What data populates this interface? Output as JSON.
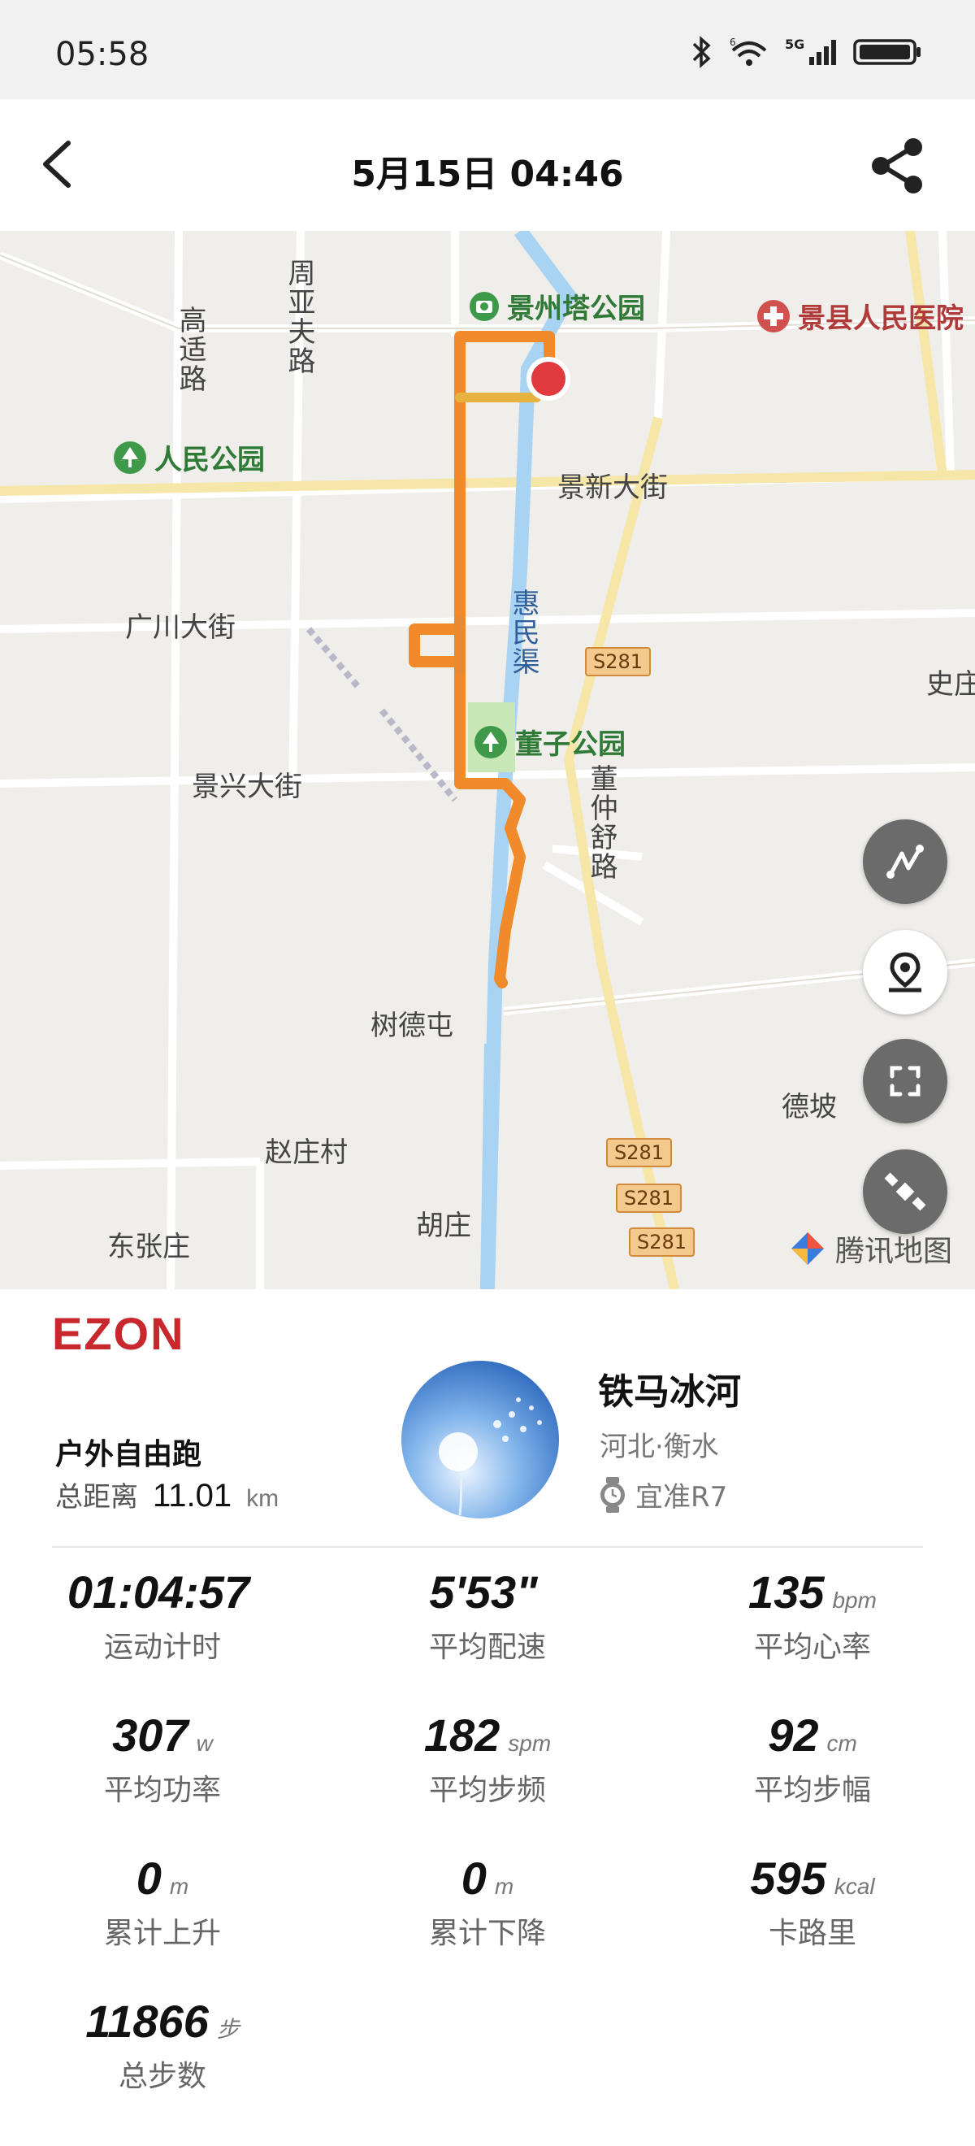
{
  "status_bar": {
    "time": "05:58",
    "signal": "5G",
    "wifi_badge": "6"
  },
  "header": {
    "title": "5月15日  04:46",
    "back_icon": "chevron-left-icon",
    "share_icon": "share-icon"
  },
  "map": {
    "labels": {
      "gaoshi_road": "高适路",
      "zhouya_road": "周亚夫路",
      "jingzhou_park": "景州塔公园",
      "county_hospital": "景县人民医院",
      "renmin_park": "人民公园",
      "jingxin_street": "景新大街",
      "guangchuan_street": "广川大街",
      "huimin_canal": "惠民渠",
      "dongzi_park": "董子公园",
      "jingxing_street": "景兴大街",
      "dongzhongshu_road": "董仲舒路",
      "shi": "史庄",
      "shudetun": "树德屯",
      "depo": "德坡",
      "zhaozhuang": "赵庄村",
      "dongzhang": "东张庄",
      "huzhuang": "胡庄"
    },
    "road_badges": [
      "S281",
      "S281",
      "S281",
      "S281"
    ],
    "brand": "腾讯地图",
    "buttons": [
      "route-icon",
      "location-pin-icon",
      "fullscreen-icon",
      "satellite-icon"
    ]
  },
  "summary": {
    "brand": "EZON",
    "sport_type": "户外自由跑",
    "distance_label": "总距离",
    "distance_value": "11.01",
    "distance_unit": "km",
    "user_name": "铁马冰河",
    "location": "河北·衡水",
    "device": "宜准R7",
    "stats": [
      {
        "value": "01:04:57",
        "unit": "",
        "label": "运动计时"
      },
      {
        "value": "5'53\"",
        "unit": "",
        "label": "平均配速"
      },
      {
        "value": "135",
        "unit": "bpm",
        "label": "平均心率"
      },
      {
        "value": "307",
        "unit": "w",
        "label": "平均功率"
      },
      {
        "value": "182",
        "unit": "spm",
        "label": "平均步频"
      },
      {
        "value": "92",
        "unit": "cm",
        "label": "平均步幅"
      },
      {
        "value": "0",
        "unit": "m",
        "label": "累计上升"
      },
      {
        "value": "0",
        "unit": "m",
        "label": "累计下降"
      },
      {
        "value": "595",
        "unit": "kcal",
        "label": "卡路里"
      },
      {
        "value": "11866",
        "unit": "步",
        "label": "总步数"
      }
    ]
  },
  "colors": {
    "route": "#f08a2a",
    "end_marker": "#e03a3e",
    "brand_red": "#c8282d"
  }
}
